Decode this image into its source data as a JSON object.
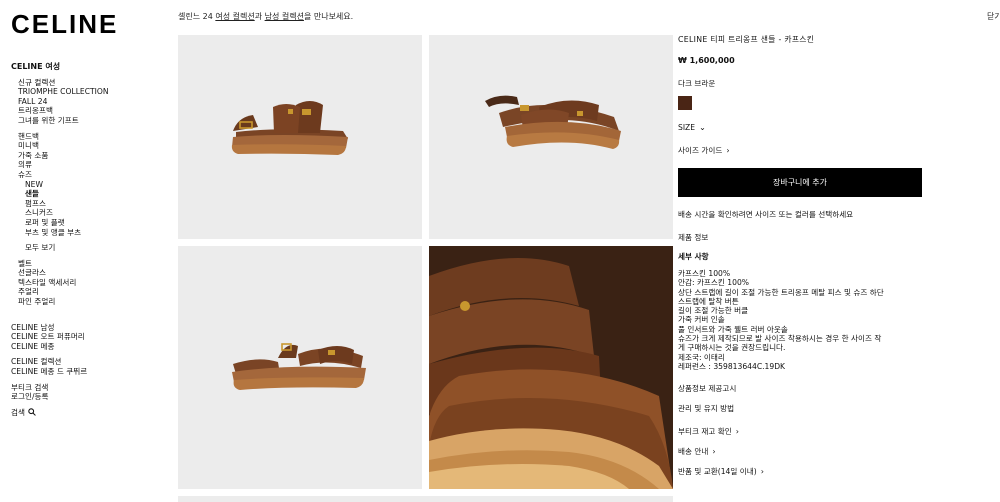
{
  "logo": "CELINE",
  "banner": {
    "prefix": "셀린느 24 ",
    "link1": "여성 컬렉션",
    "mid": "과 ",
    "link2": "남성 컬렉션",
    "suffix": "을 만나보세요."
  },
  "top_right": "닫기",
  "sidebar": {
    "heading": "CELINE 여성",
    "group1": [
      "신규 컬렉션",
      "TRIOMPHE COLLECTION",
      "FALL 24",
      "트리옹프백",
      "그녀를 위한 기프트"
    ],
    "group2": [
      "핸드백",
      "미니백",
      "가죽 소품",
      "의류",
      "슈즈"
    ],
    "shoes_sub": [
      "NEW",
      "샌들",
      "펌프스",
      "스니커즈",
      "로퍼 및 플랫",
      "부츠 및 앵클 부츠"
    ],
    "view_all": "모두 보기",
    "group3": [
      "벨트",
      "선글라스",
      "텍스타일 액세서리",
      "주얼리",
      "파인 주얼리"
    ],
    "group4": [
      "CELINE 남성",
      "CELINE 오트 퍼퓨머리",
      "CELINE 메종"
    ],
    "group5": [
      "CELINE 컬렉션",
      "CELINE 메종 드 쿠뛰르"
    ],
    "group6": [
      "부티크 검색",
      "로그인/등록"
    ],
    "search": "검색"
  },
  "product": {
    "title": "CELINE 티피 트리옹프 샌들 - 카프스킨",
    "price": "₩ 1,600,000",
    "color_label": "다크 브라운",
    "swatch_color": "#4a2515",
    "size_label": "SIZE",
    "size_guide": "사이즈 가이드",
    "add_to_cart": "장바구니에 추가",
    "shipping_note": "배송 시간을 확인하려면 사이즈 또는 컬러를 선택하세요",
    "product_info": "제품 정보",
    "details_title": "세부 사항",
    "details": [
      "카프스킨 100%",
      "안감: 카프스킨 100%",
      "상단 스트랩에 길이 조절 가능한 트리옹프 메탈 피스 및 슈즈 하단",
      "스트랩에 탈착 버튼",
      "길이 조절 가능한 버클",
      "가죽 커버 인솔",
      "풀 인서트와 가죽 웰트 러버 아웃솔",
      "슈즈가 크게 제작되므로 발 사이즈 착용하시는 경우 한 사이즈 작",
      "게 구매하시는 것을 권장드립니다.",
      "제조국: 이태리",
      "레퍼런스 : 359813644C.19DK"
    ],
    "links": [
      "상품정보 제공고시",
      "관리 및 유지 방법",
      "부티크 재고 확인",
      "배송 안내",
      "반품 및 교환(14일 이내)"
    ]
  }
}
